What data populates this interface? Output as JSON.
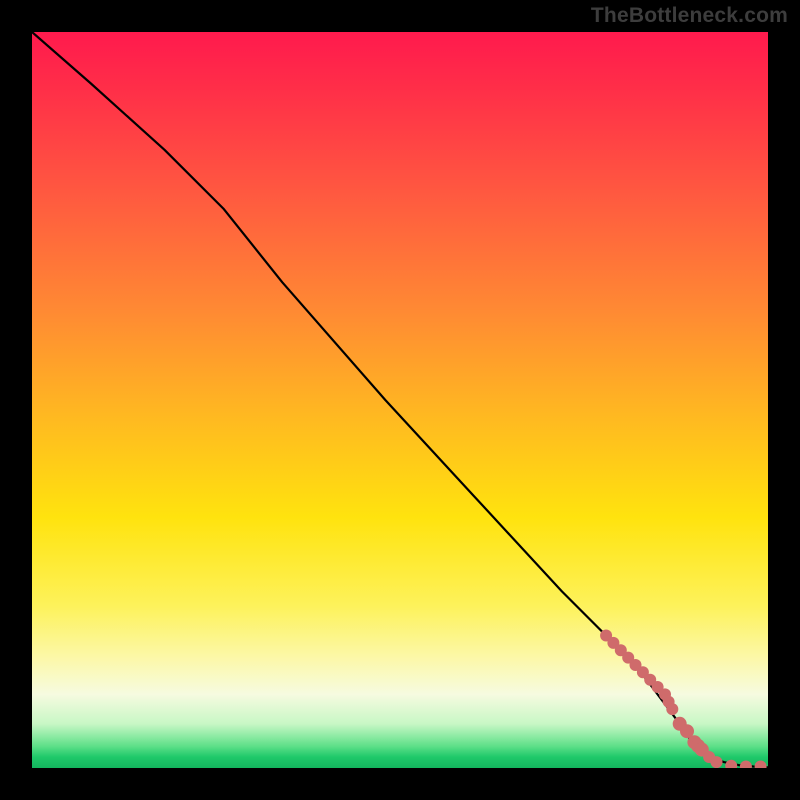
{
  "watermark": "TheBottleneck.com",
  "colors": {
    "marker": "#cf6b6b",
    "curve": "#000000",
    "bg": "#000000"
  },
  "chart_data": {
    "type": "line",
    "title": "",
    "xlabel": "",
    "ylabel": "",
    "xlim": [
      0,
      100
    ],
    "ylim": [
      0,
      100
    ],
    "curve": {
      "x": [
        0,
        8,
        18,
        26,
        34,
        48,
        60,
        72,
        82,
        88,
        90,
        92,
        94,
        96,
        98,
        100
      ],
      "y": [
        100,
        93,
        84,
        76,
        66,
        50,
        37,
        24,
        14,
        6,
        3,
        1.5,
        0.8,
        0.4,
        0.2,
        0.1
      ]
    },
    "markers": {
      "x": [
        78,
        79,
        80,
        81,
        82,
        83,
        84,
        85,
        86,
        86.5,
        87,
        88,
        89,
        90,
        90.5,
        91,
        92,
        93,
        95,
        97,
        99
      ],
      "y": [
        18,
        17,
        16,
        15,
        14,
        13,
        12,
        11,
        10,
        9,
        8,
        6,
        5,
        3.5,
        3,
        2.5,
        1.5,
        0.8,
        0.3,
        0.2,
        0.2
      ],
      "r": [
        6,
        6,
        6,
        6,
        6,
        6,
        6,
        6,
        6,
        6,
        6,
        7,
        7,
        7,
        7,
        7,
        6,
        6,
        6,
        6,
        6
      ]
    }
  }
}
